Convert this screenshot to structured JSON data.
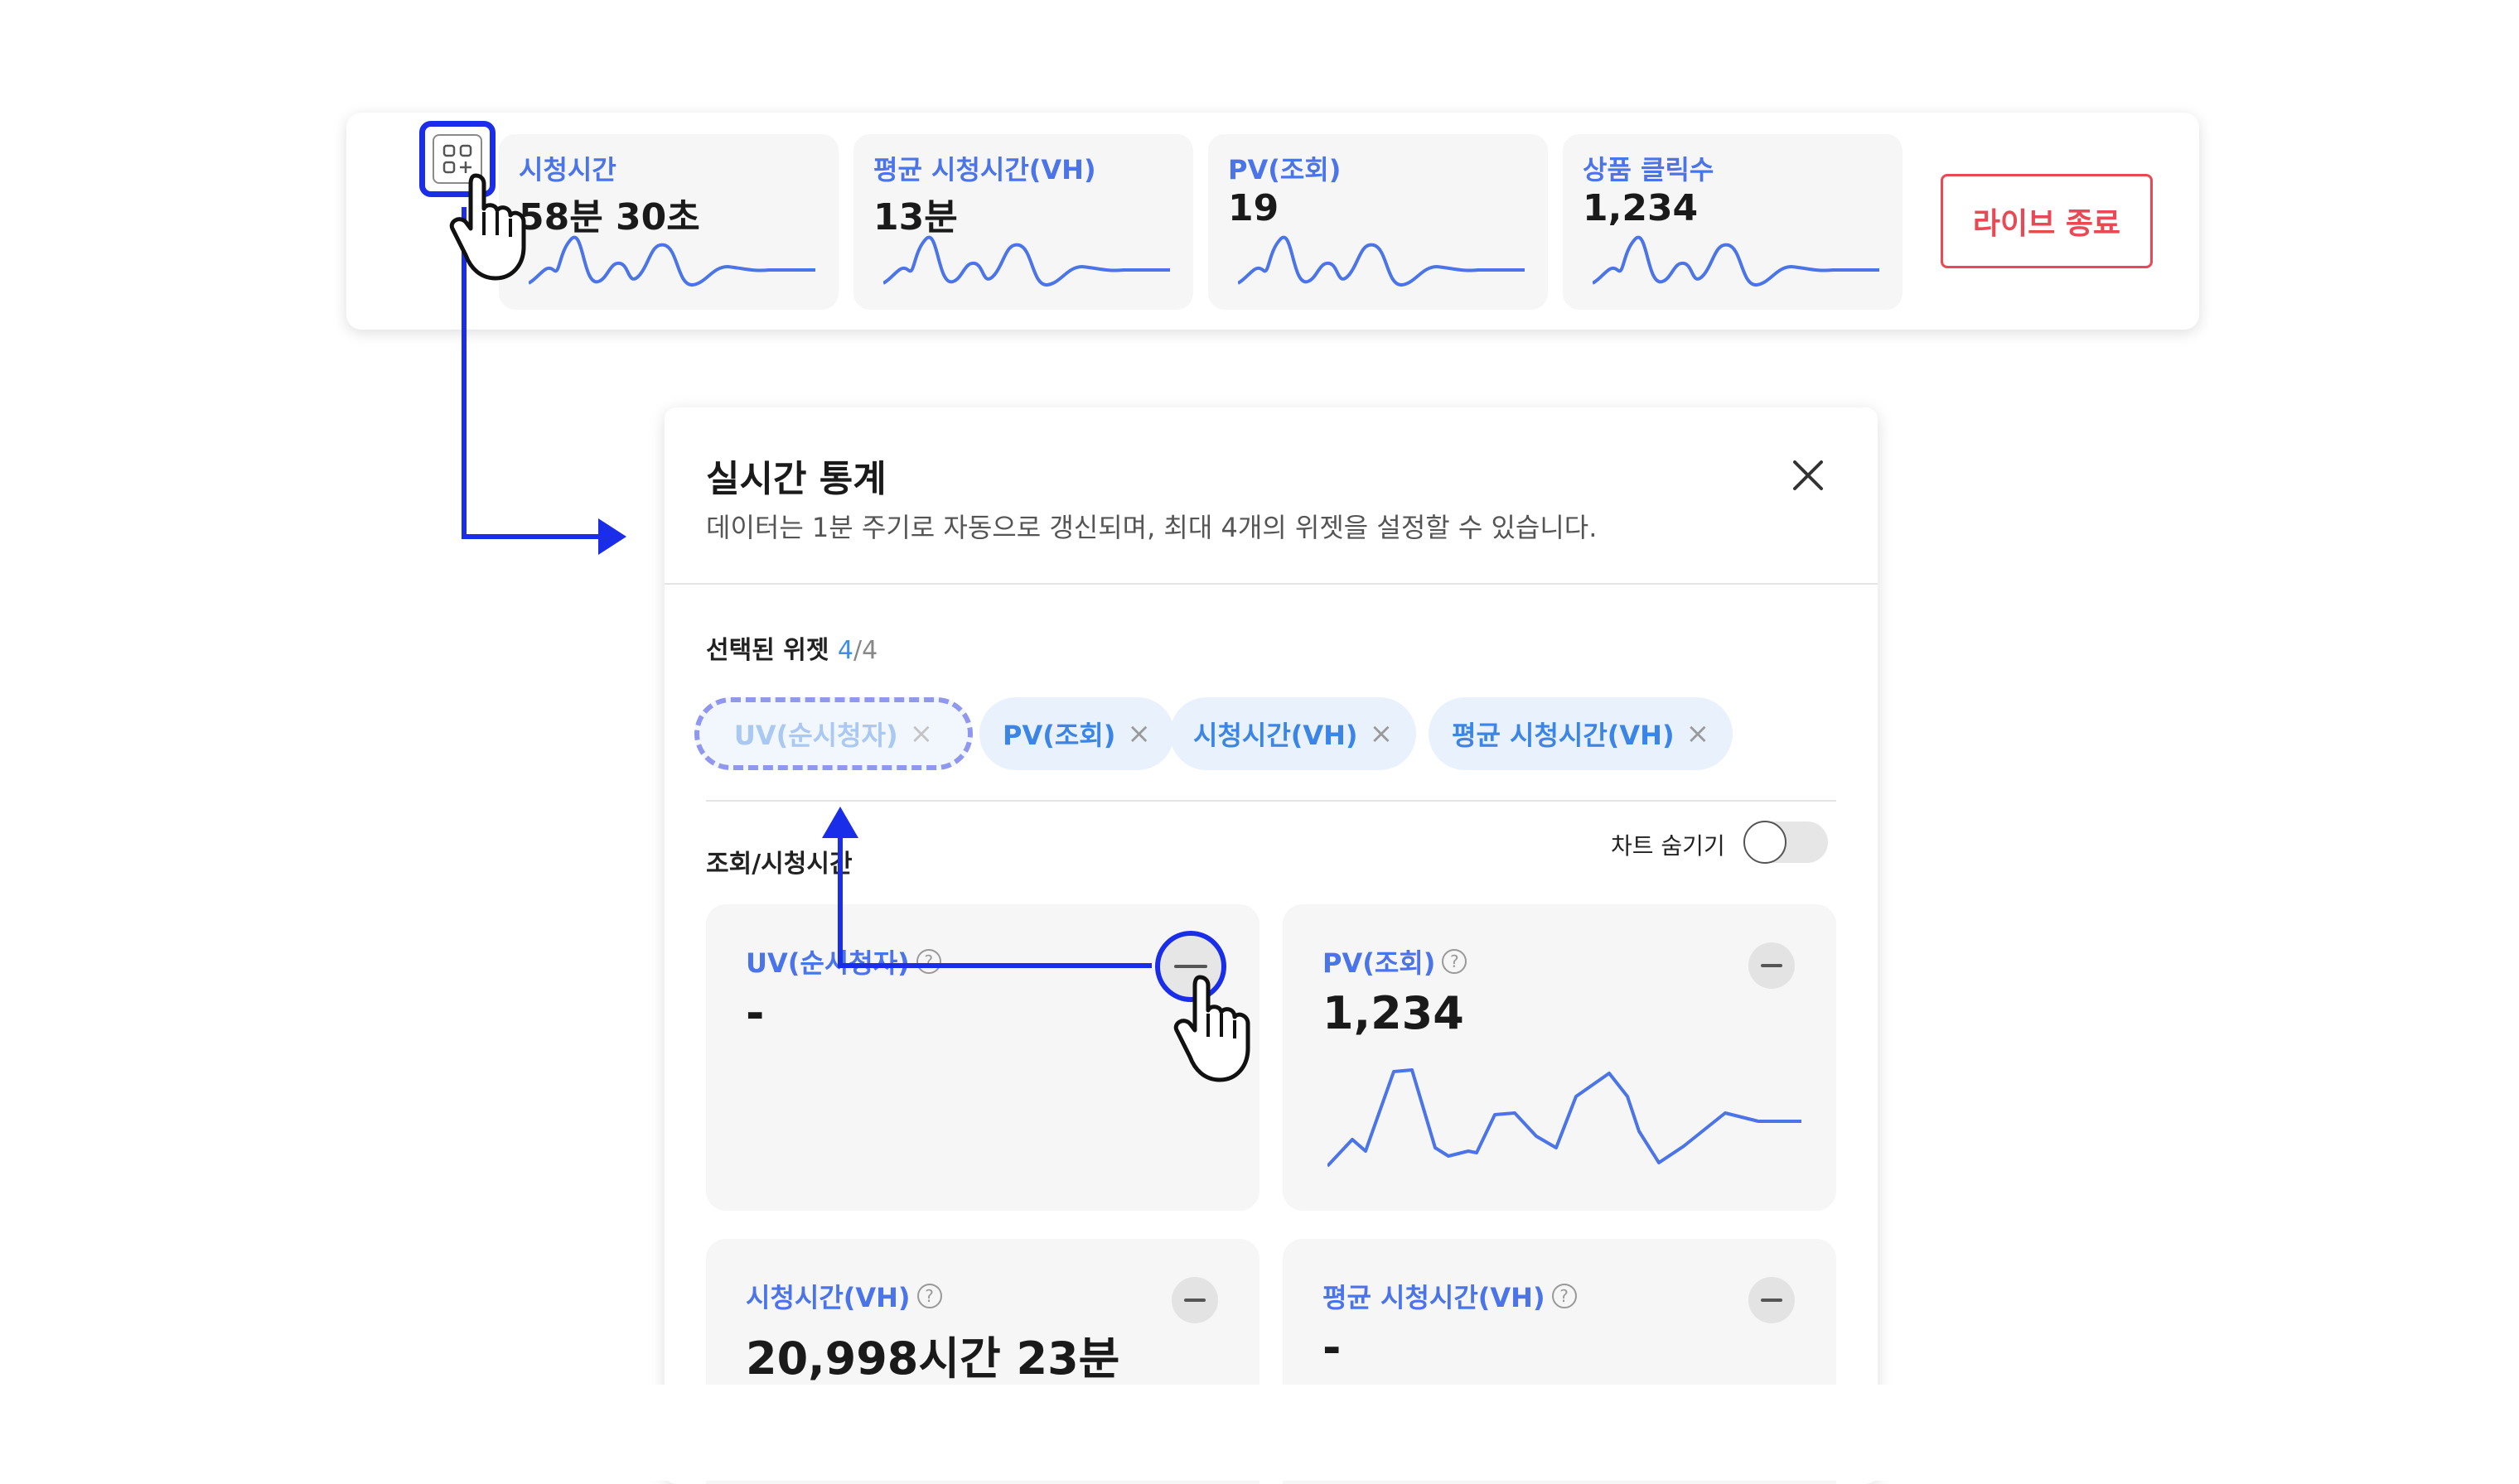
{
  "colors": {
    "accent": "#4a74e8",
    "annotation": "#1a2de8",
    "danger": "#e84a55",
    "chip_bg": "#e9f1fc"
  },
  "topbar": {
    "widget_settings_icon": "widget-add-icon",
    "stats": [
      {
        "label": "시청시간",
        "value": "58분 30초"
      },
      {
        "label": "평균 시청시간(VH)",
        "value": "13분"
      },
      {
        "label": "PV(조회)",
        "value": "19"
      },
      {
        "label": "상품 클릭수",
        "value": "1,234"
      }
    ],
    "end_live_label": "라이브 종료"
  },
  "modal": {
    "title": "실시간 통계",
    "description": "데이터는 1분 주기로 자동으로 갱신되며, 최대 4개의 위젯을 설정할 수 있습니다.",
    "selected": {
      "label": "선택된 위젯",
      "count": "4",
      "total": "/4",
      "chips": [
        {
          "label": "UV(순시청자)"
        },
        {
          "label": "PV(조회)"
        },
        {
          "label": "시청시간(VH)"
        },
        {
          "label": "평균 시청시간(VH)"
        }
      ],
      "chip_remove_glyph": "×"
    },
    "section_label": "조회/시청시간",
    "hide_chart_label": "차트 숨기기",
    "hide_chart_on": false,
    "help_glyph": "?",
    "widgets": [
      {
        "label": "UV(순시청자)",
        "value": "-"
      },
      {
        "label": "PV(조회)",
        "value": "1,234"
      },
      {
        "label": "시청시간(VH)",
        "value": "20,998시간 23분"
      },
      {
        "label": "평균 시청시간(VH)",
        "value": "-"
      }
    ]
  }
}
